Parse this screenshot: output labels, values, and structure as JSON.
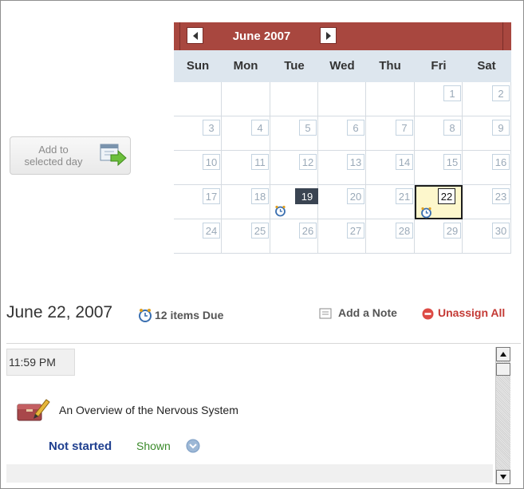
{
  "add_button": {
    "line1": "Add to",
    "line2": "selected day"
  },
  "calendar": {
    "month_title": "June 2007",
    "weekdays": [
      "Sun",
      "Mon",
      "Tue",
      "Wed",
      "Thu",
      "Fri",
      "Sat"
    ],
    "weeks": [
      [
        "",
        "",
        "",
        "",
        "",
        "1",
        "2"
      ],
      [
        "3",
        "4",
        "5",
        "6",
        "7",
        "8",
        "9"
      ],
      [
        "10",
        "11",
        "12",
        "13",
        "14",
        "15",
        "16"
      ],
      [
        "17",
        "18",
        "19",
        "20",
        "21",
        "22",
        "23"
      ],
      [
        "24",
        "25",
        "26",
        "27",
        "28",
        "29",
        "30"
      ]
    ],
    "today": "19",
    "selected": "22",
    "days_with_items": [
      "19",
      "22"
    ],
    "colors": {
      "header": "#a8473f",
      "today": "#3a4452",
      "selected_bg": "#fdf7cc"
    }
  },
  "detail": {
    "date": "June 22, 2007",
    "due_label": "12 items Due",
    "add_note_label": "Add a Note",
    "unassign_all_label": "Unassign All"
  },
  "items": [
    {
      "time": "11:59 PM",
      "title": "An Overview of the Nervous System",
      "status": "Not started",
      "visibility": "Shown",
      "icon": "assignment-pencil-icon"
    }
  ]
}
